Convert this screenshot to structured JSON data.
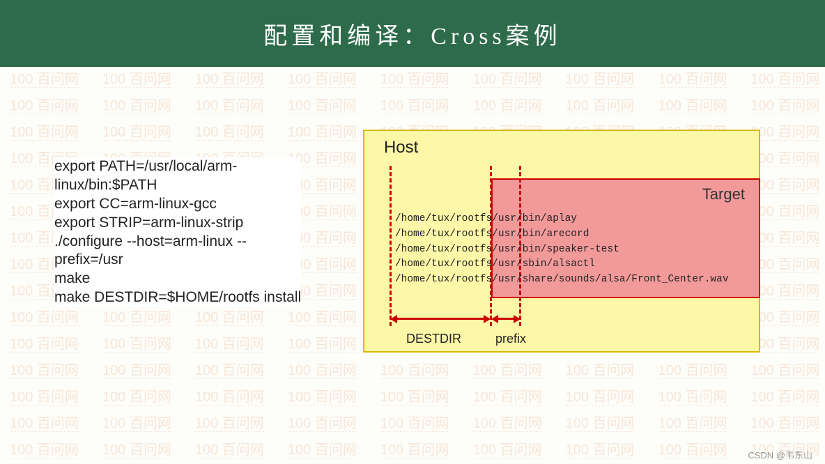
{
  "header": {
    "title": "配置和编译：Cross案例"
  },
  "watermark": {
    "text": "100 百问网"
  },
  "commands": {
    "l1": "export PATH=/usr/local/arm-",
    "l2": "linux/bin:$PATH",
    "l3": "export CC=arm-linux-gcc",
    "l4": "export STRIP=arm-linux-strip",
    "l5": "./configure --host=arm-linux --",
    "l6": "prefix=/usr",
    "l7": "make",
    "l8": "make DESTDIR=$HOME/rootfs install"
  },
  "diagram": {
    "host_label": "Host",
    "target_label": "Target",
    "paths": {
      "p1": "/home/tux/rootfs/usr/bin/aplay",
      "p2": "/home/tux/rootfs/usr/bin/arecord",
      "p3": "/home/tux/rootfs/usr/bin/speaker-test",
      "p4": "/home/tux/rootfs/usr/sbin/alsactl",
      "p5": "/home/tux/rootfs/usr/share/sounds/alsa/Front_Center.wav"
    },
    "destdir_label": "DESTDIR",
    "prefix_label": "prefix"
  },
  "footer": {
    "attribution": "CSDN @韦东山"
  }
}
